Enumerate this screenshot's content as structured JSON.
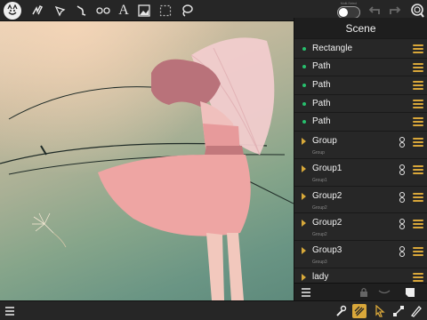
{
  "toolbar": {
    "logo_icon": "smiley-cat-icon",
    "tools": [
      {
        "name": "brush-tool-icon"
      },
      {
        "name": "pen-tool-icon"
      },
      {
        "name": "bezier-tool-icon"
      },
      {
        "name": "node-tool-icon"
      },
      {
        "name": "text-tool-icon",
        "glyph": "A"
      },
      {
        "name": "image-tool-icon"
      },
      {
        "name": "selection-rect-icon"
      },
      {
        "name": "lasso-tool-icon"
      }
    ],
    "multiselect_label": "Multi-Select",
    "undo_icon": "undo-icon",
    "redo_icon": "redo-icon",
    "zoom_icon": "zoom-icon"
  },
  "panel": {
    "title": "Scene",
    "layers": [
      {
        "label": "Rectangle",
        "kind": "path"
      },
      {
        "label": "Path",
        "kind": "path"
      },
      {
        "label": "Path",
        "kind": "path"
      },
      {
        "label": "Path",
        "kind": "path"
      },
      {
        "label": "Path",
        "kind": "path"
      },
      {
        "label": "Group",
        "kind": "group",
        "sub": "Group"
      },
      {
        "label": "Group1",
        "kind": "group",
        "sub": "Group1"
      },
      {
        "label": "Group2",
        "kind": "group",
        "sub": "Group2"
      },
      {
        "label": "Group2",
        "kind": "group",
        "sub": "Group2"
      },
      {
        "label": "Group3",
        "kind": "group",
        "sub": "Group3"
      },
      {
        "label": "lady",
        "kind": "group",
        "sub": ""
      }
    ]
  },
  "colors": {
    "accent": "#d9a73a",
    "bullet": "#27c06d"
  }
}
